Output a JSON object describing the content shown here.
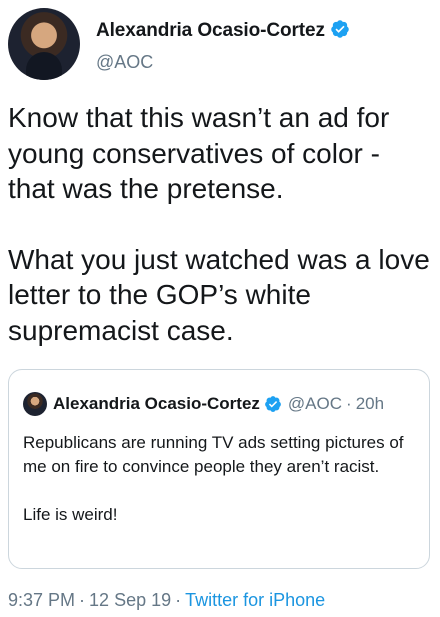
{
  "author": {
    "display_name": "Alexandria Ocasio-Cortez",
    "handle": "@AOC",
    "verified_icon": "verified-badge-icon",
    "accent_color": "#1da1f2"
  },
  "tweet": {
    "paragraphs": [
      "Know that this wasn’t an ad for young conservatives of color - that was the pretense.",
      "What you just watched was a love letter to the GOP’s white supremacist case."
    ]
  },
  "quoted_tweet": {
    "display_name": "Alexandria Ocasio-Cortez",
    "handle": "@AOC",
    "separator": "·",
    "age": "20h",
    "paragraphs": [
      "Republicans are running TV ads setting pictures of me on fire to convince people they aren’t racist.",
      "Life is weird!"
    ]
  },
  "footer": {
    "time": "9:37 PM",
    "separator": "·",
    "date": "12 Sep 19",
    "source": "Twitter for iPhone"
  }
}
